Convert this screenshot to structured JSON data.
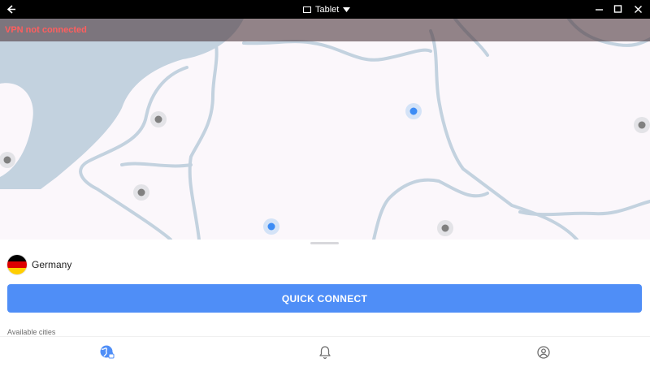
{
  "window": {
    "mode_label": "Tablet"
  },
  "status": {
    "text": "VPN not connected",
    "color": "#ff5e5e"
  },
  "map": {
    "land_color": "#fbf7fb",
    "water_color": "#c3d2df",
    "pins": [
      {
        "state": "available",
        "color": "#808080"
      },
      {
        "state": "available",
        "color": "#808080"
      },
      {
        "state": "available",
        "color": "#808080"
      },
      {
        "state": "connectable",
        "color": "#3d8cf5"
      },
      {
        "state": "connectable",
        "color": "#3d8cf5"
      },
      {
        "state": "available",
        "color": "#808080"
      },
      {
        "state": "available",
        "color": "#808080"
      }
    ]
  },
  "sheet": {
    "country": "Germany",
    "quick_connect_label": "QUICK CONNECT",
    "available_cities_label": "Available cities",
    "accent_color": "#4f8ef7"
  },
  "nav": {
    "items": [
      {
        "icon": "globe-lock-icon",
        "active": true
      },
      {
        "icon": "bell-icon",
        "active": false
      },
      {
        "icon": "profile-icon",
        "active": false
      }
    ]
  }
}
